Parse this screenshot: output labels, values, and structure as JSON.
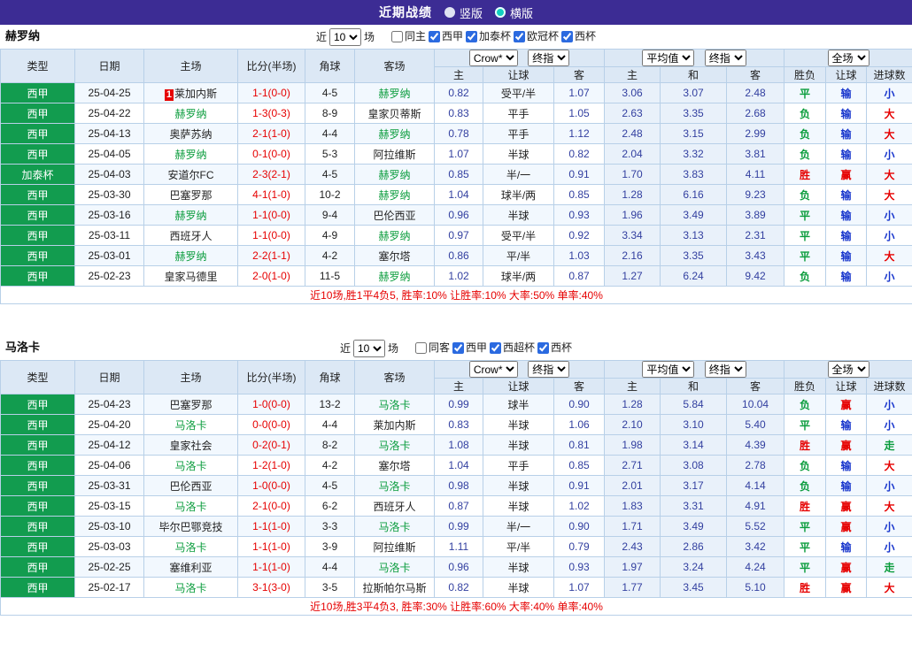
{
  "topbar": {
    "title": "近期战绩",
    "layout_options": [
      {
        "label": "竖版",
        "selected": false
      },
      {
        "label": "横版",
        "selected": true
      }
    ]
  },
  "columns": [
    "类型",
    "日期",
    "主场",
    "比分(半场)",
    "角球",
    "客场",
    "主",
    "让球",
    "客",
    "主",
    "和",
    "客",
    "胜负",
    "让球",
    "进球数"
  ],
  "colors": {
    "topbar_bg": "#3c2c94",
    "header_bg": "#dce8f5",
    "type_tag_green": "#129c4f",
    "focus_team_green": "#0a9c3c",
    "score_red": "#e60000",
    "lose_blue": "#1634cc"
  },
  "sections": [
    {
      "team": "赫罗纳",
      "filter": {
        "near_label": "近",
        "count": "10",
        "games_label": "场",
        "same_option": {
          "label": "同主",
          "checked": false
        },
        "competitions": [
          {
            "label": "西甲",
            "checked": true
          },
          {
            "label": "加泰杯",
            "checked": true
          },
          {
            "label": "欧冠杯",
            "checked": true
          },
          {
            "label": "西杯",
            "checked": true
          }
        ]
      },
      "odds_headers": {
        "crow": "Crow*",
        "crow_final": "终指",
        "avg": "平均值",
        "avg_final": "终指",
        "fulltime": "全场"
      },
      "rows": [
        {
          "type": "西甲",
          "date": "25-04-25",
          "home": "莱加内斯",
          "home_badge": "1",
          "score": "1-1(0-0)",
          "corners": "4-5",
          "away": "赫罗纳",
          "focus": "away",
          "crow_home": "0.82",
          "handicap": "受平/半",
          "crow_away": "1.07",
          "avg_home": "3.06",
          "avg_draw": "3.07",
          "avg_away": "2.48",
          "result": "平",
          "handicap_result": "输",
          "goals": "小"
        },
        {
          "type": "西甲",
          "date": "25-04-22",
          "home": "赫罗纳",
          "score": "1-3(0-3)",
          "corners": "8-9",
          "away": "皇家贝蒂斯",
          "focus": "home",
          "crow_home": "0.83",
          "handicap": "平手",
          "crow_away": "1.05",
          "avg_home": "2.63",
          "avg_draw": "3.35",
          "avg_away": "2.68",
          "result": "负",
          "handicap_result": "输",
          "goals": "大"
        },
        {
          "type": "西甲",
          "date": "25-04-13",
          "home": "奥萨苏纳",
          "score": "2-1(1-0)",
          "corners": "4-4",
          "away": "赫罗纳",
          "focus": "away",
          "crow_home": "0.78",
          "handicap": "平手",
          "crow_away": "1.12",
          "avg_home": "2.48",
          "avg_draw": "3.15",
          "avg_away": "2.99",
          "result": "负",
          "handicap_result": "输",
          "goals": "大"
        },
        {
          "type": "西甲",
          "date": "25-04-05",
          "home": "赫罗纳",
          "score": "0-1(0-0)",
          "corners": "5-3",
          "away": "阿拉维斯",
          "focus": "home",
          "crow_home": "1.07",
          "handicap": "半球",
          "crow_away": "0.82",
          "avg_home": "2.04",
          "avg_draw": "3.32",
          "avg_away": "3.81",
          "result": "负",
          "handicap_result": "输",
          "goals": "小"
        },
        {
          "type": "加泰杯",
          "date": "25-04-03",
          "home": "安道尔FC",
          "score": "2-3(2-1)",
          "corners": "4-5",
          "away": "赫罗纳",
          "focus": "away",
          "crow_home": "0.85",
          "handicap": "半/一",
          "crow_away": "0.91",
          "avg_home": "1.70",
          "avg_draw": "3.83",
          "avg_away": "4.11",
          "result": "胜",
          "handicap_result": "赢",
          "goals": "大"
        },
        {
          "type": "西甲",
          "date": "25-03-30",
          "home": "巴塞罗那",
          "score": "4-1(1-0)",
          "corners": "10-2",
          "away": "赫罗纳",
          "focus": "away",
          "crow_home": "1.04",
          "handicap": "球半/两",
          "crow_away": "0.85",
          "avg_home": "1.28",
          "avg_draw": "6.16",
          "avg_away": "9.23",
          "result": "负",
          "handicap_result": "输",
          "goals": "大"
        },
        {
          "type": "西甲",
          "date": "25-03-16",
          "home": "赫罗纳",
          "score": "1-1(0-0)",
          "corners": "9-4",
          "away": "巴伦西亚",
          "focus": "home",
          "crow_home": "0.96",
          "handicap": "半球",
          "crow_away": "0.93",
          "avg_home": "1.96",
          "avg_draw": "3.49",
          "avg_away": "3.89",
          "result": "平",
          "handicap_result": "输",
          "goals": "小"
        },
        {
          "type": "西甲",
          "date": "25-03-11",
          "home": "西班牙人",
          "score": "1-1(0-0)",
          "corners": "4-9",
          "away": "赫罗纳",
          "focus": "away",
          "crow_home": "0.97",
          "handicap": "受平/半",
          "crow_away": "0.92",
          "avg_home": "3.34",
          "avg_draw": "3.13",
          "avg_away": "2.31",
          "result": "平",
          "handicap_result": "输",
          "goals": "小"
        },
        {
          "type": "西甲",
          "date": "25-03-01",
          "home": "赫罗纳",
          "score": "2-2(1-1)",
          "corners": "4-2",
          "away": "塞尔塔",
          "focus": "home",
          "crow_home": "0.86",
          "handicap": "平/半",
          "crow_away": "1.03",
          "avg_home": "2.16",
          "avg_draw": "3.35",
          "avg_away": "3.43",
          "result": "平",
          "handicap_result": "输",
          "goals": "大"
        },
        {
          "type": "西甲",
          "date": "25-02-23",
          "home": "皇家马德里",
          "score": "2-0(1-0)",
          "corners": "11-5",
          "away": "赫罗纳",
          "focus": "away",
          "crow_home": "1.02",
          "handicap": "球半/两",
          "crow_away": "0.87",
          "avg_home": "1.27",
          "avg_draw": "6.24",
          "avg_away": "9.42",
          "result": "负",
          "handicap_result": "输",
          "goals": "小"
        }
      ],
      "summary": "近10场,胜1平4负5, 胜率:10% 让胜率:10% 大率:50% 单率:40%"
    },
    {
      "team": "马洛卡",
      "filter": {
        "near_label": "近",
        "count": "10",
        "games_label": "场",
        "same_option": {
          "label": "同客",
          "checked": false
        },
        "competitions": [
          {
            "label": "西甲",
            "checked": true
          },
          {
            "label": "西超杯",
            "checked": true
          },
          {
            "label": "西杯",
            "checked": true
          }
        ]
      },
      "odds_headers": {
        "crow": "Crow*",
        "crow_final": "终指",
        "avg": "平均值",
        "avg_final": "终指",
        "fulltime": "全场"
      },
      "rows": [
        {
          "type": "西甲",
          "date": "25-04-23",
          "home": "巴塞罗那",
          "score": "1-0(0-0)",
          "corners": "13-2",
          "away": "马洛卡",
          "focus": "away",
          "crow_home": "0.99",
          "handicap": "球半",
          "crow_away": "0.90",
          "avg_home": "1.28",
          "avg_draw": "5.84",
          "avg_away": "10.04",
          "result": "负",
          "handicap_result": "赢",
          "goals": "小"
        },
        {
          "type": "西甲",
          "date": "25-04-20",
          "home": "马洛卡",
          "score": "0-0(0-0)",
          "corners": "4-4",
          "away": "莱加内斯",
          "focus": "home",
          "crow_home": "0.83",
          "handicap": "半球",
          "crow_away": "1.06",
          "avg_home": "2.10",
          "avg_draw": "3.10",
          "avg_away": "5.40",
          "result": "平",
          "handicap_result": "输",
          "goals": "小"
        },
        {
          "type": "西甲",
          "date": "25-04-12",
          "home": "皇家社会",
          "score": "0-2(0-1)",
          "corners": "8-2",
          "away": "马洛卡",
          "focus": "away",
          "crow_home": "1.08",
          "handicap": "半球",
          "crow_away": "0.81",
          "avg_home": "1.98",
          "avg_draw": "3.14",
          "avg_away": "4.39",
          "result": "胜",
          "handicap_result": "赢",
          "goals": "走"
        },
        {
          "type": "西甲",
          "date": "25-04-06",
          "home": "马洛卡",
          "score": "1-2(1-0)",
          "corners": "4-2",
          "away": "塞尔塔",
          "focus": "home",
          "crow_home": "1.04",
          "handicap": "平手",
          "crow_away": "0.85",
          "avg_home": "2.71",
          "avg_draw": "3.08",
          "avg_away": "2.78",
          "result": "负",
          "handicap_result": "输",
          "goals": "大"
        },
        {
          "type": "西甲",
          "date": "25-03-31",
          "home": "巴伦西亚",
          "score": "1-0(0-0)",
          "corners": "4-5",
          "away": "马洛卡",
          "focus": "away",
          "crow_home": "0.98",
          "handicap": "半球",
          "crow_away": "0.91",
          "avg_home": "2.01",
          "avg_draw": "3.17",
          "avg_away": "4.14",
          "result": "负",
          "handicap_result": "输",
          "goals": "小"
        },
        {
          "type": "西甲",
          "date": "25-03-15",
          "home": "马洛卡",
          "score": "2-1(0-0)",
          "corners": "6-2",
          "away": "西班牙人",
          "focus": "home",
          "crow_home": "0.87",
          "handicap": "半球",
          "crow_away": "1.02",
          "avg_home": "1.83",
          "avg_draw": "3.31",
          "avg_away": "4.91",
          "result": "胜",
          "handicap_result": "赢",
          "goals": "大"
        },
        {
          "type": "西甲",
          "date": "25-03-10",
          "home": "毕尔巴鄂竞技",
          "score": "1-1(1-0)",
          "corners": "3-3",
          "away": "马洛卡",
          "focus": "away",
          "crow_home": "0.99",
          "handicap": "半/一",
          "crow_away": "0.90",
          "avg_home": "1.71",
          "avg_draw": "3.49",
          "avg_away": "5.52",
          "result": "平",
          "handicap_result": "赢",
          "goals": "小"
        },
        {
          "type": "西甲",
          "date": "25-03-03",
          "home": "马洛卡",
          "score": "1-1(1-0)",
          "corners": "3-9",
          "away": "阿拉维斯",
          "focus": "home",
          "crow_home": "1.11",
          "handicap": "平/半",
          "crow_away": "0.79",
          "avg_home": "2.43",
          "avg_draw": "2.86",
          "avg_away": "3.42",
          "result": "平",
          "handicap_result": "输",
          "goals": "小"
        },
        {
          "type": "西甲",
          "date": "25-02-25",
          "home": "塞维利亚",
          "score": "1-1(1-0)",
          "corners": "4-4",
          "away": "马洛卡",
          "focus": "away",
          "crow_home": "0.96",
          "handicap": "半球",
          "crow_away": "0.93",
          "avg_home": "1.97",
          "avg_draw": "3.24",
          "avg_away": "4.24",
          "result": "平",
          "handicap_result": "赢",
          "goals": "走"
        },
        {
          "type": "西甲",
          "date": "25-02-17",
          "home": "马洛卡",
          "score": "3-1(3-0)",
          "corners": "3-5",
          "away": "拉斯帕尔马斯",
          "focus": "home",
          "crow_home": "0.82",
          "handicap": "半球",
          "crow_away": "1.07",
          "avg_home": "1.77",
          "avg_draw": "3.45",
          "avg_away": "5.10",
          "result": "胜",
          "handicap_result": "赢",
          "goals": "大"
        }
      ],
      "summary": "近10场,胜3平4负3, 胜率:30% 让胜率:60% 大率:40% 单率:40%"
    }
  ]
}
